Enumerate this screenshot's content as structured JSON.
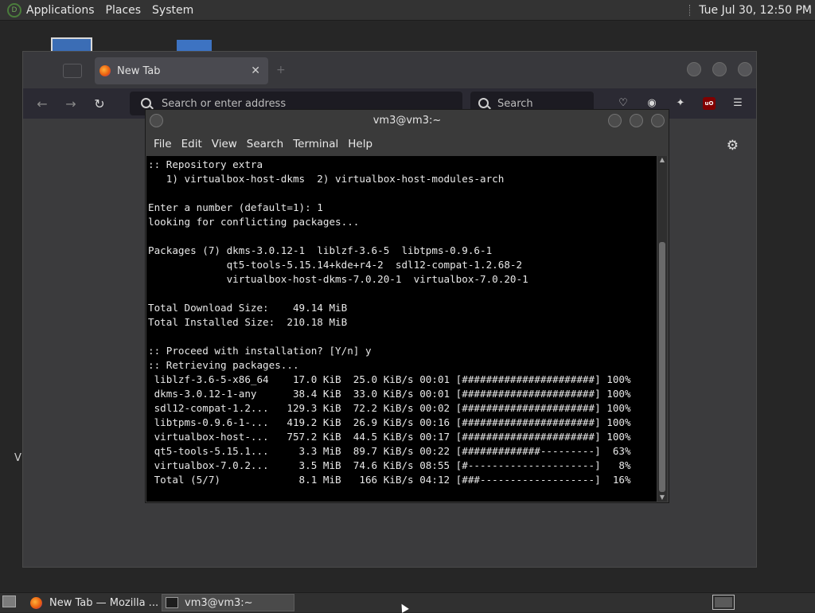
{
  "top_panel": {
    "menus": [
      "Applications",
      "Places",
      "System"
    ],
    "clock": "Tue Jul 30, 12:50 PM"
  },
  "desktop": {
    "partial_label": "V"
  },
  "firefox": {
    "tab_title": "New Tab",
    "url_placeholder": "Search or enter address",
    "search_placeholder": "Search",
    "ublock_badge": "uO"
  },
  "terminal": {
    "title": "vm3@vm3:~",
    "menus": [
      "File",
      "Edit",
      "View",
      "Search",
      "Terminal",
      "Help"
    ],
    "lines": [
      ":: Repository extra",
      "   1) virtualbox-host-dkms  2) virtualbox-host-modules-arch",
      "",
      "Enter a number (default=1): 1",
      "looking for conflicting packages...",
      "",
      "Packages (7) dkms-3.0.12-1  liblzf-3.6-5  libtpms-0.9.6-1",
      "             qt5-tools-5.15.14+kde+r4-2  sdl12-compat-1.2.68-2",
      "             virtualbox-host-dkms-7.0.20-1  virtualbox-7.0.20-1",
      "",
      "Total Download Size:    49.14 MiB",
      "Total Installed Size:  210.18 MiB",
      "",
      ":: Proceed with installation? [Y/n] y",
      ":: Retrieving packages...",
      " liblzf-3.6-5-x86_64    17.0 KiB  25.0 KiB/s 00:01 [######################] 100%",
      " dkms-3.0.12-1-any      38.4 KiB  33.0 KiB/s 00:01 [######################] 100%",
      " sdl12-compat-1.2...   129.3 KiB  72.2 KiB/s 00:02 [######################] 100%",
      " libtpms-0.9.6-1-...   419.2 KiB  26.9 KiB/s 00:16 [######################] 100%",
      " virtualbox-host-...   757.2 KiB  44.5 KiB/s 00:17 [######################] 100%",
      " qt5-tools-5.15.1...     3.3 MiB  89.7 KiB/s 00:22 [#############---------]  63%",
      " virtualbox-7.0.2...     3.5 MiB  74.6 KiB/s 08:55 [#---------------------]   8%",
      " Total (5/7)             8.1 MiB   166 KiB/s 04:12 [###-------------------]  16%"
    ]
  },
  "taskbar": {
    "tasks": [
      "New Tab — Mozilla ...",
      "vm3@vm3:~"
    ]
  },
  "colors": {
    "panel": "#333333",
    "terminal_bg": "#000000",
    "firefox_toolbar": "#2b2a33"
  }
}
